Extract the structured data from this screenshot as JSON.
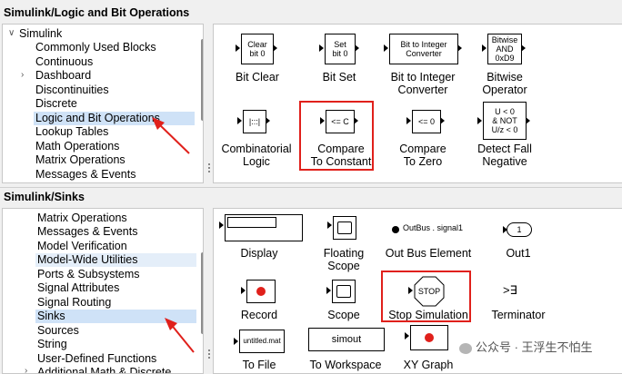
{
  "top": {
    "header": "Simulink/Logic and Bit Operations",
    "tree": [
      "Simulink",
      "Commonly Used Blocks",
      "Continuous",
      "Dashboard",
      "Discontinuities",
      "Discrete",
      "Logic and Bit Operations",
      "Lookup Tables",
      "Math Operations",
      "Matrix Operations",
      "Messages & Events"
    ],
    "blocks": {
      "bit_clear": {
        "icon": "Clear\nbit 0",
        "label": "Bit Clear"
      },
      "bit_set": {
        "icon": "Set\nbit 0",
        "label": "Bit Set"
      },
      "bit_to_int": {
        "icon": "Bit to Integer\nConverter",
        "label": "Bit to Integer\nConverter"
      },
      "bitwise": {
        "icon": "Bitwise\nAND\n0xD9",
        "label": "Bitwise\nOperator"
      },
      "combinatorial": {
        "icon": "|:::|",
        "label": "Combinatorial\nLogic"
      },
      "compare_const": {
        "icon": "<= C",
        "label": "Compare\nTo Constant"
      },
      "compare_zero": {
        "icon": "<= 0",
        "label": "Compare\nTo Zero"
      },
      "detect_fall": {
        "icon": "U < 0\n& NOT\nU/z < 0",
        "label": "Detect Fall\nNegative"
      }
    }
  },
  "bottom": {
    "header": "Simulink/Sinks",
    "tree": [
      "Matrix Operations",
      "Messages & Events",
      "Model Verification",
      "Model-Wide Utilities",
      "Ports & Subsystems",
      "Signal Attributes",
      "Signal Routing",
      "Sinks",
      "Sources",
      "String",
      "User-Defined Functions",
      "Additional Math & Discrete"
    ],
    "blocks": {
      "display": {
        "label": "Display"
      },
      "floating_scope": {
        "label": "Floating\nScope"
      },
      "outbus": {
        "icon": "OutBus . signal1",
        "label": "Out Bus Element"
      },
      "out1": {
        "icon": "1",
        "label": "Out1"
      },
      "record": {
        "label": "Record"
      },
      "scope": {
        "label": "Scope"
      },
      "stop": {
        "icon": "STOP",
        "label": "Stop Simulation"
      },
      "terminator": {
        "label": "Terminator"
      },
      "to_file": {
        "icon": "untitled.mat",
        "label": "To File"
      },
      "to_workspace": {
        "icon": "simout",
        "label": "To Workspace"
      },
      "xy_graph": {
        "label": "XY Graph"
      }
    }
  },
  "watermark": "公众号 · 王浮生不怕生",
  "colors": {
    "highlight_box": "#e0201b",
    "selection": "#cfe2f7",
    "arrow": "#e0201b",
    "record_dot": "#e0201b"
  }
}
